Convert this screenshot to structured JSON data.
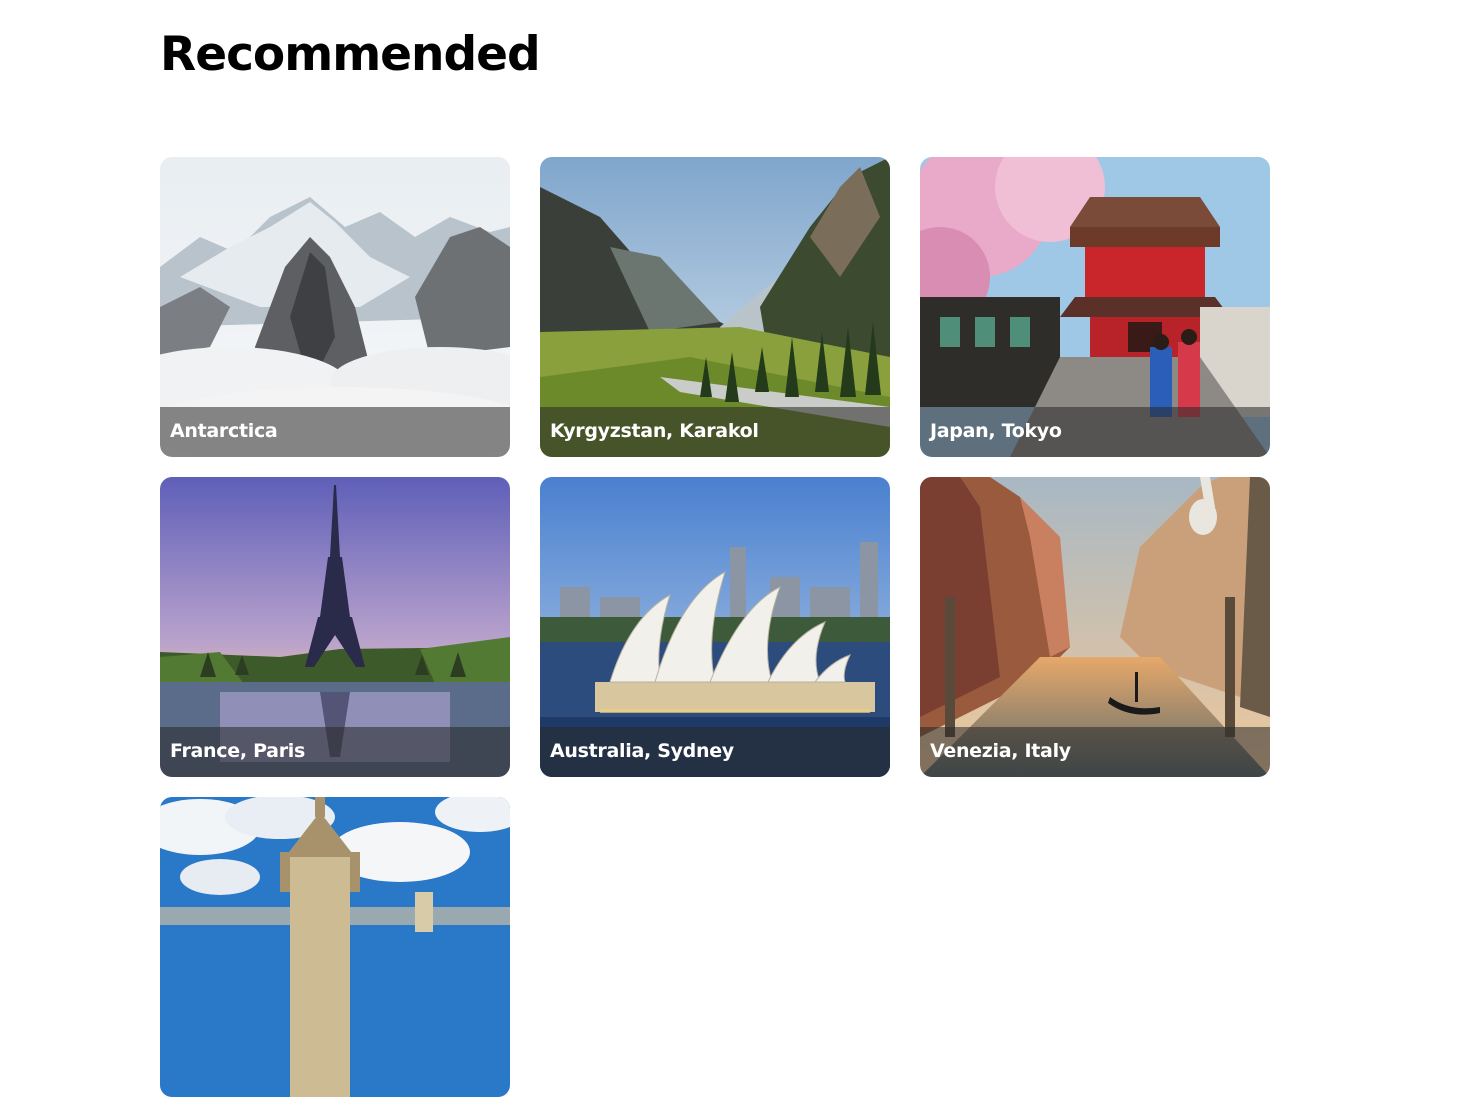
{
  "page": {
    "title": "Recommended"
  },
  "destinations": [
    {
      "label": "Antarctica"
    },
    {
      "label": "Kyrgyzstan, Karakol"
    },
    {
      "label": "Japan, Tokyo"
    },
    {
      "label": "France, Paris"
    },
    {
      "label": "Australia, Sydney"
    },
    {
      "label": "Venezia, Italy"
    },
    {
      "label": ""
    }
  ]
}
